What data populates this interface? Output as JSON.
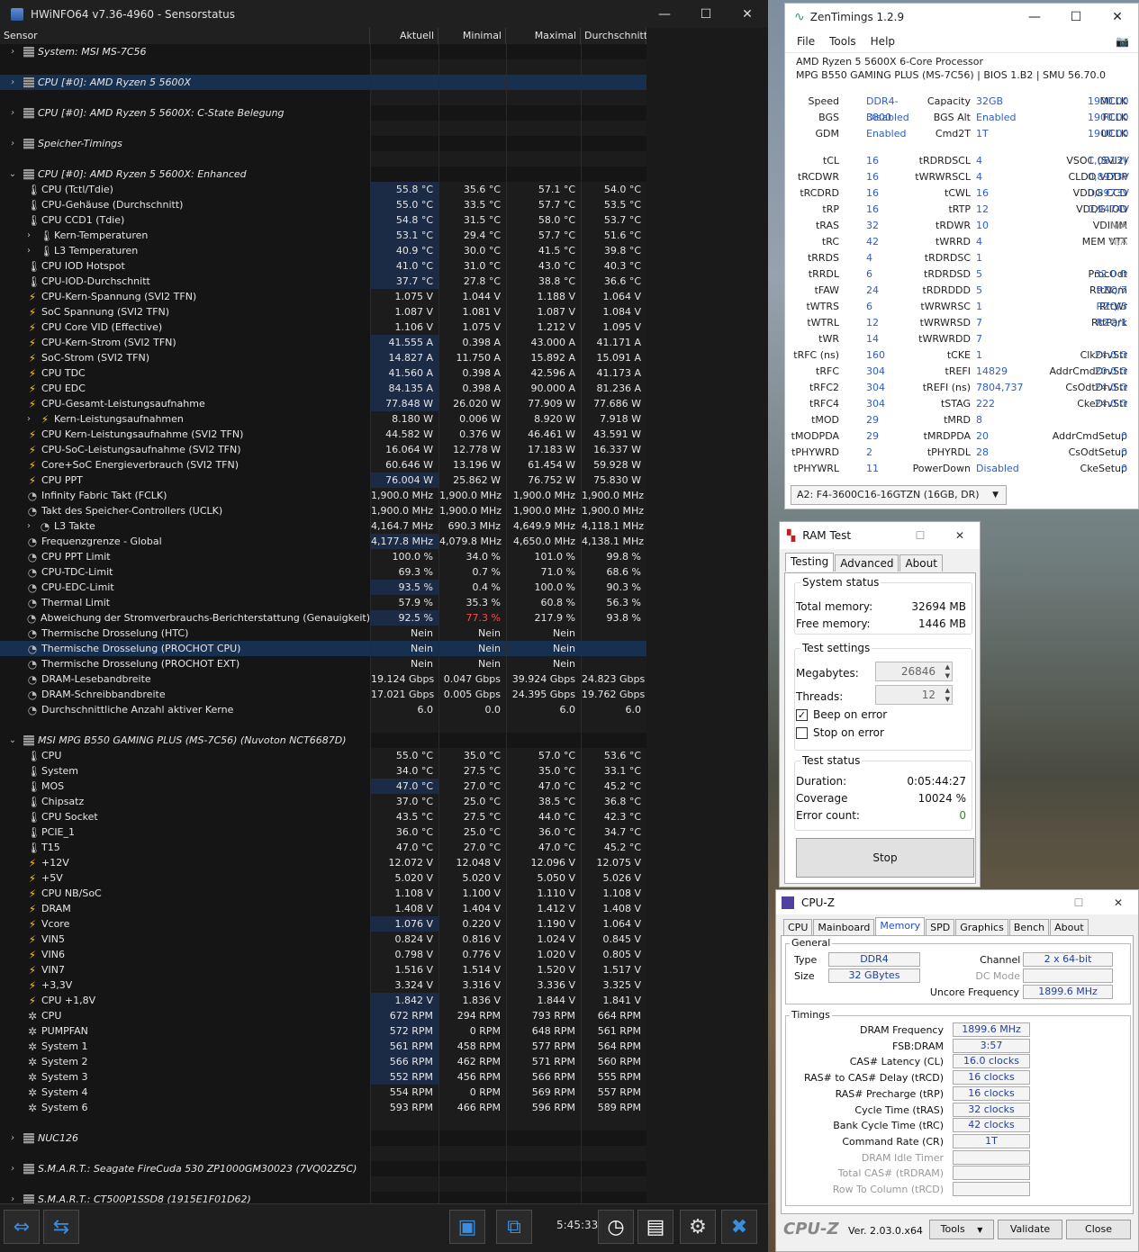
{
  "hwinfo": {
    "title": "HWiNFO64 v7.36-4960 - Sensorstatus",
    "columns": [
      "Sensor",
      "Aktuell",
      "Minimal",
      "Maximal",
      "Durchschnitt"
    ],
    "rows": [
      {
        "t": "g",
        "exp": "›",
        "label": "System: MSI MS-7C56"
      },
      {
        "t": "b"
      },
      {
        "t": "g",
        "exp": "›",
        "label": "CPU [#0]: AMD Ryzen 5 5600X",
        "sel": true
      },
      {
        "t": "b"
      },
      {
        "t": "g",
        "exp": "›",
        "label": "CPU [#0]: AMD Ryzen 5 5600X: C-State Belegung"
      },
      {
        "t": "b"
      },
      {
        "t": "g",
        "exp": "›",
        "label": "Speicher-Timings"
      },
      {
        "t": "b"
      },
      {
        "t": "g",
        "exp": "⌄",
        "label": "CPU [#0]: AMD Ryzen 5 5600X: Enhanced"
      },
      {
        "i": "temp",
        "label": "CPU (Tctl/Tdie)",
        "v": [
          "55.8 °C",
          "35.6 °C",
          "57.1 °C",
          "54.0 °C"
        ],
        "hl": true
      },
      {
        "i": "temp",
        "label": "CPU-Gehäuse (Durchschnitt)",
        "v": [
          "55.0 °C",
          "33.5 °C",
          "57.7 °C",
          "53.5 °C"
        ],
        "hl": true
      },
      {
        "i": "temp",
        "label": "CPU CCD1 (Tdie)",
        "v": [
          "54.8 °C",
          "31.5 °C",
          "58.0 °C",
          "53.7 °C"
        ],
        "hl": true
      },
      {
        "i": "temp",
        "sub": true,
        "label": "Kern-Temperaturen",
        "v": [
          "53.1 °C",
          "29.4 °C",
          "57.7 °C",
          "51.6 °C"
        ],
        "hl": true
      },
      {
        "i": "temp",
        "sub": true,
        "label": "L3 Temperaturen",
        "v": [
          "40.9 °C",
          "30.0 °C",
          "41.5 °C",
          "39.8 °C"
        ],
        "hl": true
      },
      {
        "i": "temp",
        "label": "CPU IOD Hotspot",
        "v": [
          "41.0 °C",
          "31.0 °C",
          "43.0 °C",
          "40.3 °C"
        ],
        "hl": true
      },
      {
        "i": "temp",
        "label": "CPU-IOD-Durchschnitt",
        "v": [
          "37.7 °C",
          "27.8 °C",
          "38.8 °C",
          "36.6 °C"
        ],
        "hl": true
      },
      {
        "i": "volt",
        "label": "CPU-Kern-Spannung (SVI2 TFN)",
        "v": [
          "1.075 V",
          "1.044 V",
          "1.188 V",
          "1.064 V"
        ]
      },
      {
        "i": "volt",
        "label": "SoC Spannung (SVI2 TFN)",
        "v": [
          "1.087 V",
          "1.081 V",
          "1.087 V",
          "1.084 V"
        ]
      },
      {
        "i": "volt",
        "label": "CPU Core VID (Effective)",
        "v": [
          "1.106 V",
          "1.075 V",
          "1.212 V",
          "1.095 V"
        ]
      },
      {
        "i": "volt",
        "label": "CPU-Kern-Strom (SVI2 TFN)",
        "v": [
          "41.555 A",
          "0.398 A",
          "43.000 A",
          "41.171 A"
        ],
        "hl": true
      },
      {
        "i": "volt",
        "label": "SoC-Strom (SVI2 TFN)",
        "v": [
          "14.827 A",
          "11.750 A",
          "15.892 A",
          "15.091 A"
        ],
        "hl": true
      },
      {
        "i": "volt",
        "label": "CPU TDC",
        "v": [
          "41.560 A",
          "0.398 A",
          "42.596 A",
          "41.173 A"
        ],
        "hl": true
      },
      {
        "i": "volt",
        "label": "CPU EDC",
        "v": [
          "84.135 A",
          "0.398 A",
          "90.000 A",
          "81.236 A"
        ],
        "hl": true
      },
      {
        "i": "volt",
        "label": "CPU-Gesamt-Leistungsaufnahme",
        "v": [
          "77.848 W",
          "26.020 W",
          "77.909 W",
          "77.686 W"
        ],
        "hl": true
      },
      {
        "i": "volt",
        "sub": true,
        "label": "Kern-Leistungsaufnahmen",
        "v": [
          "8.180 W",
          "0.006 W",
          "8.920 W",
          "7.918 W"
        ]
      },
      {
        "i": "volt",
        "label": "CPU Kern-Leistungsaufnahme (SVI2 TFN)",
        "v": [
          "44.582 W",
          "0.376 W",
          "46.461 W",
          "43.591 W"
        ]
      },
      {
        "i": "volt",
        "label": "CPU-SoC-Leistungsaufnahme (SVI2 TFN)",
        "v": [
          "16.064 W",
          "12.778 W",
          "17.183 W",
          "16.337 W"
        ]
      },
      {
        "i": "volt",
        "label": "Core+SoC Energieverbrauch (SVI2 TFN)",
        "v": [
          "60.646 W",
          "13.196 W",
          "61.454 W",
          "59.928 W"
        ]
      },
      {
        "i": "volt",
        "label": "CPU PPT",
        "v": [
          "76.004 W",
          "25.862 W",
          "76.752 W",
          "75.830 W"
        ],
        "hl": true
      },
      {
        "i": "clock",
        "label": "Infinity Fabric Takt (FCLK)",
        "v": [
          "1,900.0 MHz",
          "1,900.0 MHz",
          "1,900.0 MHz",
          "1,900.0 MHz"
        ]
      },
      {
        "i": "clock",
        "label": "Takt des Speicher-Controllers (UCLK)",
        "v": [
          "1,900.0 MHz",
          "1,900.0 MHz",
          "1,900.0 MHz",
          "1,900.0 MHz"
        ]
      },
      {
        "i": "clock",
        "sub": true,
        "label": "L3 Takte",
        "v": [
          "4,164.7 MHz",
          "690.3 MHz",
          "4,649.9 MHz",
          "4,118.1 MHz"
        ]
      },
      {
        "i": "clock",
        "label": "Frequenzgrenze - Global",
        "v": [
          "4,177.8 MHz",
          "4,079.8 MHz",
          "4,650.0 MHz",
          "4,138.1 MHz"
        ],
        "hl": true
      },
      {
        "i": "clock",
        "label": "CPU PPT Limit",
        "v": [
          "100.0 %",
          "34.0 %",
          "101.0 %",
          "99.8 %"
        ]
      },
      {
        "i": "clock",
        "label": "CPU-TDC-Limit",
        "v": [
          "69.3 %",
          "0.7 %",
          "71.0 %",
          "68.6 %"
        ]
      },
      {
        "i": "clock",
        "label": "CPU-EDC-Limit",
        "v": [
          "93.5 %",
          "0.4 %",
          "100.0 %",
          "90.3 %"
        ],
        "hl": true
      },
      {
        "i": "clock",
        "label": "Thermal Limit",
        "v": [
          "57.9 %",
          "35.3 %",
          "60.8 %",
          "56.3 %"
        ]
      },
      {
        "i": "clock",
        "label": "Abweichung der Stromverbrauchs-Berichterstattung (Genauigkeit)",
        "v": [
          "92.5 %",
          "77.3 %",
          "217.9 %",
          "93.8 %"
        ],
        "hl": true,
        "redmin": true
      },
      {
        "i": "clock",
        "label": "Thermische Drosselung (HTC)",
        "v": [
          "Nein",
          "Nein",
          "Nein",
          ""
        ]
      },
      {
        "i": "clock",
        "label": "Thermische Drosselung (PROCHOT CPU)",
        "v": [
          "Nein",
          "Nein",
          "Nein",
          ""
        ],
        "sel": true
      },
      {
        "i": "clock",
        "label": "Thermische Drosselung (PROCHOT EXT)",
        "v": [
          "Nein",
          "Nein",
          "Nein",
          ""
        ]
      },
      {
        "i": "clock",
        "label": "DRAM-Lesebandbreite",
        "v": [
          "19.124 Gbps",
          "0.047 Gbps",
          "39.924 Gbps",
          "24.823 Gbps"
        ]
      },
      {
        "i": "clock",
        "label": "DRAM-Schreibbandbreite",
        "v": [
          "17.021 Gbps",
          "0.005 Gbps",
          "24.395 Gbps",
          "19.762 Gbps"
        ]
      },
      {
        "i": "clock",
        "label": "Durchschnittliche Anzahl aktiver Kerne",
        "v": [
          "6.0",
          "0.0",
          "6.0",
          "6.0"
        ]
      },
      {
        "t": "b"
      },
      {
        "t": "g",
        "exp": "⌄",
        "label": "MSI MPG B550 GAMING PLUS (MS-7C56) (Nuvoton NCT6687D)"
      },
      {
        "i": "temp",
        "label": "CPU",
        "v": [
          "55.0 °C",
          "35.0 °C",
          "57.0 °C",
          "53.6 °C"
        ]
      },
      {
        "i": "temp",
        "label": "System",
        "v": [
          "34.0 °C",
          "27.5 °C",
          "35.0 °C",
          "33.1 °C"
        ]
      },
      {
        "i": "temp",
        "label": "MOS",
        "v": [
          "47.0 °C",
          "27.0 °C",
          "47.0 °C",
          "45.2 °C"
        ],
        "hl": true
      },
      {
        "i": "temp",
        "label": "Chipsatz",
        "v": [
          "37.0 °C",
          "25.0 °C",
          "38.5 °C",
          "36.8 °C"
        ]
      },
      {
        "i": "temp",
        "label": "CPU Socket",
        "v": [
          "43.5 °C",
          "27.5 °C",
          "44.0 °C",
          "42.3 °C"
        ]
      },
      {
        "i": "temp",
        "label": "PCIE_1",
        "v": [
          "36.0 °C",
          "25.0 °C",
          "36.0 °C",
          "34.7 °C"
        ]
      },
      {
        "i": "temp",
        "label": "T15",
        "v": [
          "47.0 °C",
          "27.0 °C",
          "47.0 °C",
          "45.2 °C"
        ]
      },
      {
        "i": "volt",
        "label": "+12V",
        "v": [
          "12.072 V",
          "12.048 V",
          "12.096 V",
          "12.075 V"
        ]
      },
      {
        "i": "volt",
        "label": "+5V",
        "v": [
          "5.020 V",
          "5.020 V",
          "5.050 V",
          "5.026 V"
        ]
      },
      {
        "i": "volt",
        "label": "CPU NB/SoC",
        "v": [
          "1.108 V",
          "1.100 V",
          "1.110 V",
          "1.108 V"
        ]
      },
      {
        "i": "volt",
        "label": "DRAM",
        "v": [
          "1.408 V",
          "1.404 V",
          "1.412 V",
          "1.408 V"
        ]
      },
      {
        "i": "volt",
        "label": "Vcore",
        "v": [
          "1.076 V",
          "0.220 V",
          "1.190 V",
          "1.064 V"
        ],
        "hl": true
      },
      {
        "i": "volt",
        "label": "VIN5",
        "v": [
          "0.824 V",
          "0.816 V",
          "1.024 V",
          "0.845 V"
        ]
      },
      {
        "i": "volt",
        "label": "VIN6",
        "v": [
          "0.798 V",
          "0.776 V",
          "1.020 V",
          "0.805 V"
        ]
      },
      {
        "i": "volt",
        "label": "VIN7",
        "v": [
          "1.516 V",
          "1.514 V",
          "1.520 V",
          "1.517 V"
        ]
      },
      {
        "i": "volt",
        "label": "+3,3V",
        "v": [
          "3.324 V",
          "3.316 V",
          "3.336 V",
          "3.325 V"
        ]
      },
      {
        "i": "volt",
        "label": "CPU +1,8V",
        "v": [
          "1.842 V",
          "1.836 V",
          "1.844 V",
          "1.841 V"
        ],
        "hl": true
      },
      {
        "i": "fan",
        "label": "CPU",
        "v": [
          "672 RPM",
          "294 RPM",
          "793 RPM",
          "664 RPM"
        ],
        "hl": true
      },
      {
        "i": "fan",
        "label": "PUMPFAN",
        "v": [
          "572 RPM",
          "0 RPM",
          "648 RPM",
          "561 RPM"
        ],
        "hl": true
      },
      {
        "i": "fan",
        "label": "System 1",
        "v": [
          "561 RPM",
          "458 RPM",
          "577 RPM",
          "564 RPM"
        ],
        "hl": true
      },
      {
        "i": "fan",
        "label": "System 2",
        "v": [
          "566 RPM",
          "462 RPM",
          "571 RPM",
          "560 RPM"
        ],
        "hl": true
      },
      {
        "i": "fan",
        "label": "System 3",
        "v": [
          "552 RPM",
          "456 RPM",
          "566 RPM",
          "555 RPM"
        ],
        "hl": true
      },
      {
        "i": "fan",
        "label": "System 4",
        "v": [
          "554 RPM",
          "0 RPM",
          "569 RPM",
          "557 RPM"
        ]
      },
      {
        "i": "fan",
        "label": "System 6",
        "v": [
          "593 RPM",
          "466 RPM",
          "596 RPM",
          "589 RPM"
        ]
      },
      {
        "t": "b"
      },
      {
        "t": "g",
        "exp": "›",
        "label": "NUC126"
      },
      {
        "t": "b"
      },
      {
        "t": "g",
        "exp": "›",
        "label": "S.M.A.R.T.: Seagate FireCuda 530 ZP1000GM30023 (7VQ02Z5C)"
      },
      {
        "t": "b"
      },
      {
        "t": "g",
        "exp": "›",
        "label": "S.M.A.R.T.: CT500P1SSD8 (1915E1F01D62)"
      }
    ],
    "time": "5:45:33"
  },
  "zentimings": {
    "title": "ZenTimings 1.2.9",
    "menu": [
      "File",
      "Tools",
      "Help"
    ],
    "cpu": "AMD Ryzen 5 5600X 6-Core Processor",
    "board": "MPG B550 GAMING PLUS (MS-7C56) | BIOS 1.B2 | SMU 56.70.0",
    "top": [
      [
        [
          "Speed",
          "DDR4-3800"
        ],
        [
          "Capacity",
          "32GB"
        ],
        [
          "MCLK",
          "1900.00"
        ]
      ],
      [
        [
          "BGS",
          "Disabled"
        ],
        [
          "BGS Alt",
          "Enabled"
        ],
        [
          "FCLK",
          "1900.00"
        ]
      ],
      [
        [
          "GDM",
          "Enabled"
        ],
        [
          "Cmd2T",
          "1T"
        ],
        [
          "UCLK",
          "1900.00"
        ]
      ]
    ],
    "timings": [
      [
        [
          "tCL",
          "16"
        ],
        [
          "tRDRDSCL",
          "4"
        ],
        [
          "VSOC (SVI2)",
          "1,0813V"
        ]
      ],
      [
        [
          "tRCDWR",
          "16"
        ],
        [
          "tWRWRSCL",
          "4"
        ],
        [
          "CLDO VDDP",
          "0,8973V"
        ]
      ],
      [
        [
          "tRCDRD",
          "16"
        ],
        [
          "tCWL",
          "16"
        ],
        [
          "VDDG CCD",
          "0,8973V"
        ]
      ],
      [
        [
          "tRP",
          "16"
        ],
        [
          "tRTP",
          "12"
        ],
        [
          "VDDG IOD",
          "0,9474V"
        ]
      ],
      [
        [
          "tRAS",
          "32"
        ],
        [
          "tRDWR",
          "10"
        ],
        [
          "VDIMM",
          "N/A"
        ]
      ],
      [
        [
          "tRC",
          "42"
        ],
        [
          "tWRRD",
          "4"
        ],
        [
          "MEM VTT",
          "N/A"
        ]
      ],
      [
        [
          "tRRDS",
          "4"
        ],
        [
          "tRDRDSC",
          "1"
        ],
        [
          "",
          ""
        ]
      ],
      [
        [
          "tRRDL",
          "6"
        ],
        [
          "tRDRDSD",
          "5"
        ],
        [
          "ProcOdt",
          "32.0 Ω"
        ]
      ],
      [
        [
          "tFAW",
          "24"
        ],
        [
          "tRDRDDD",
          "5"
        ],
        [
          "RttNom",
          "RZQ/7"
        ]
      ],
      [
        [
          "tWTRS",
          "6"
        ],
        [
          "tWRWRSC",
          "1"
        ],
        [
          "RttWr",
          "RZQ/3"
        ]
      ],
      [
        [
          "tWTRL",
          "12"
        ],
        [
          "tWRWRSD",
          "7"
        ],
        [
          "RttPark",
          "RZQ/1"
        ]
      ],
      [
        [
          "tWR",
          "14"
        ],
        [
          "tWRWRDD",
          "7"
        ],
        [
          "",
          ""
        ]
      ],
      [
        [
          "tRFC (ns)",
          "160"
        ],
        [
          "tCKE",
          "1"
        ],
        [
          "ClkDrvStr",
          "24.0 Ω"
        ]
      ],
      [
        [
          "tRFC",
          "304"
        ],
        [
          "tREFI",
          "14829"
        ],
        [
          "AddrCmdDrvStr",
          "20.0 Ω"
        ]
      ],
      [
        [
          "tRFC2",
          "304"
        ],
        [
          "tREFI (ns)",
          "7804,737"
        ],
        [
          "CsOdtDrvStr",
          "24.0 Ω"
        ]
      ],
      [
        [
          "tRFC4",
          "304"
        ],
        [
          "tSTAG",
          "222"
        ],
        [
          "CkeDrvStr",
          "24.0 Ω"
        ]
      ],
      [
        [
          "tMOD",
          "29"
        ],
        [
          "tMRD",
          "8"
        ],
        [
          "",
          ""
        ]
      ],
      [
        [
          "tMODPDA",
          "29"
        ],
        [
          "tMRDPDA",
          "20"
        ],
        [
          "AddrCmdSetup",
          "0"
        ]
      ],
      [
        [
          "tPHYWRD",
          "2"
        ],
        [
          "tPHYRDL",
          "28"
        ],
        [
          "CsOdtSetup",
          "0"
        ]
      ],
      [
        [
          "tPHYWRL",
          "11"
        ],
        [
          "PowerDown",
          "Disabled"
        ],
        [
          "CkeSetup",
          "0"
        ]
      ]
    ],
    "module": "A2: F4-3600C16-16GTZN (16GB, DR)"
  },
  "ramtest": {
    "title": "RAM Test",
    "tabs": [
      "Testing",
      "Advanced",
      "About"
    ],
    "system_status": "System status",
    "total_memory_label": "Total memory:",
    "total_memory": "32694 MB",
    "free_memory_label": "Free memory:",
    "free_memory": "1446 MB",
    "test_settings": "Test settings",
    "megabytes_label": "Megabytes:",
    "megabytes": "26846",
    "threads_label": "Threads:",
    "threads": "12",
    "beep_label": "Beep on error",
    "stop_label": "Stop on error",
    "test_status": "Test status",
    "duration_label": "Duration:",
    "duration": "0:05:44:27",
    "coverage_label": "Coverage",
    "coverage": "10024 %",
    "errors_label": "Error count:",
    "errors": "0",
    "stop_button": "Stop"
  },
  "cpuz": {
    "title": "CPU-Z",
    "tabs": [
      "CPU",
      "Mainboard",
      "Memory",
      "SPD",
      "Graphics",
      "Bench",
      "About"
    ],
    "general": "General",
    "type_label": "Type",
    "type": "DDR4",
    "size_label": "Size",
    "size": "32 GBytes",
    "channel_label": "Channel #",
    "channel": "2 x 64-bit",
    "dc_label": "DC Mode",
    "uncore_label": "Uncore Frequency",
    "uncore": "1899.6 MHz",
    "timings": "Timings",
    "trows": [
      [
        "DRAM Frequency",
        "1899.6 MHz"
      ],
      [
        "FSB:DRAM",
        "3:57"
      ],
      [
        "CAS# Latency (CL)",
        "16.0 clocks"
      ],
      [
        "RAS# to CAS# Delay (tRCD)",
        "16 clocks"
      ],
      [
        "RAS# Precharge (tRP)",
        "16 clocks"
      ],
      [
        "Cycle Time (tRAS)",
        "32 clocks"
      ],
      [
        "Bank Cycle Time (tRC)",
        "42 clocks"
      ],
      [
        "Command Rate (CR)",
        "1T"
      ],
      [
        "DRAM Idle Timer",
        ""
      ],
      [
        "Total CAS# (tRDRAM)",
        ""
      ],
      [
        "Row To Column (tRCD)",
        ""
      ]
    ],
    "logo": "CPU-Z",
    "version": "Ver. 2.03.0.x64",
    "tools": "Tools",
    "validate": "Validate",
    "close": "Close"
  }
}
